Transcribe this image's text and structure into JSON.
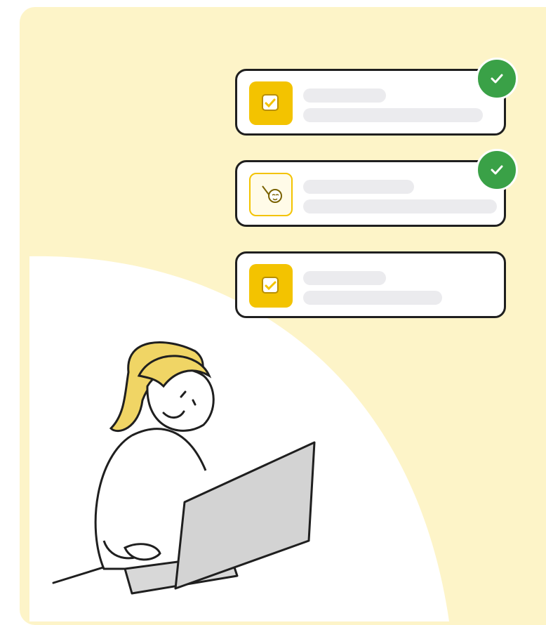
{
  "colors": {
    "panel_background": "#fdf4c8",
    "accent_yellow": "#f3c300",
    "check_green": "#3aa147",
    "placeholder_bar": "#ebebee"
  },
  "tasks": [
    {
      "icon": "checklist-document-icon",
      "status": "completed"
    },
    {
      "icon": "pencil-face-icon",
      "status": "completed"
    },
    {
      "icon": "checklist-document-icon",
      "status": "pending"
    }
  ],
  "illustration": {
    "subject": "person-typing-on-laptop"
  }
}
